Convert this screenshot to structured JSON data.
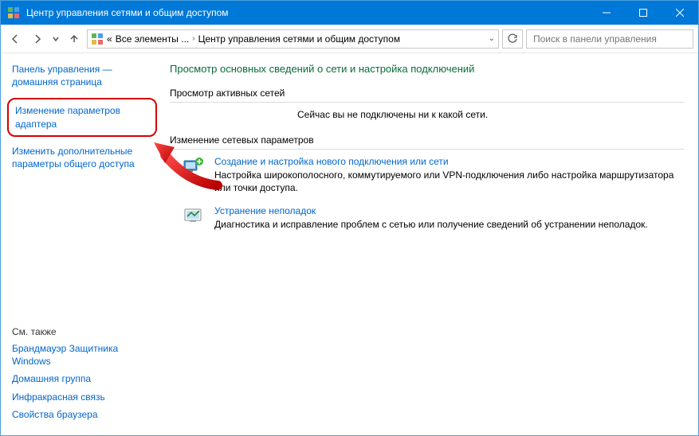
{
  "titlebar": {
    "title": "Центр управления сетями и общим доступом"
  },
  "nav": {
    "crumb_prefix": "«",
    "crumb1": "Все элементы ...",
    "crumb2": "Центр управления сетями и общим доступом",
    "search_placeholder": "Поиск в панели управления"
  },
  "sidebar": {
    "home": "Панель управления — домашняя страница",
    "item1": "Изменение параметров адаптера",
    "item2": "Изменить дополнительные параметры общего доступа",
    "see_also_title": "См. также",
    "see_also": {
      "firewall": "Брандмауэр Защитника Windows",
      "homegroup": "Домашняя группа",
      "irda": "Инфракрасная связь",
      "inetopts": "Свойства браузера"
    }
  },
  "main": {
    "heading": "Просмотр основных сведений о сети и настройка подключений",
    "active_title": "Просмотр активных сетей",
    "active_msg": "Сейчас вы не подключены ни к какой сети.",
    "settings_title": "Изменение сетевых параметров",
    "task1": {
      "title": "Создание и настройка нового подключения или сети",
      "desc": "Настройка широкополосного, коммутируемого или VPN-подключения либо настройка маршрутизатора или точки доступа."
    },
    "task2": {
      "title": "Устранение неполадок",
      "desc": "Диагностика и исправление проблем с сетью или получение сведений об устранении неполадок."
    }
  }
}
